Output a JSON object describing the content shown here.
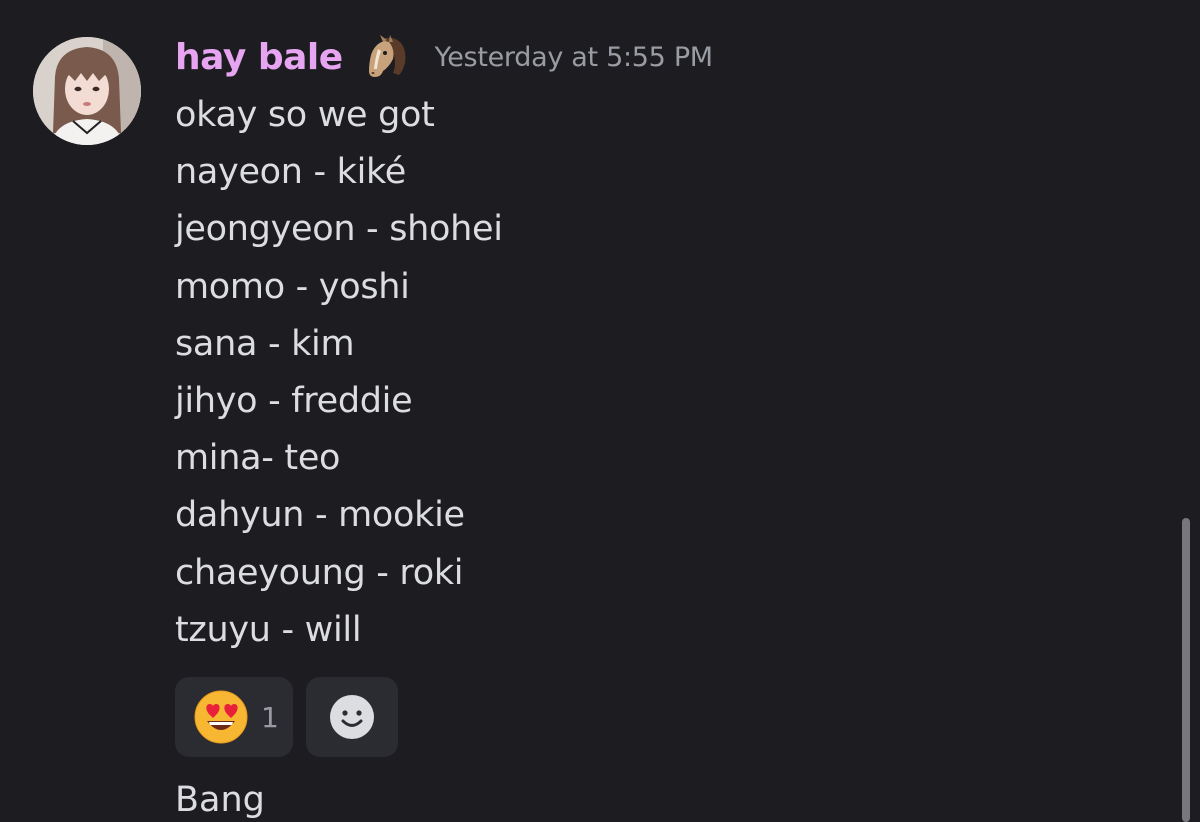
{
  "message": {
    "author": "hay bale",
    "badge_icon": "horse-face-icon",
    "timestamp": "Yesterday at 5:55 PM",
    "lines": [
      "okay so we got",
      "nayeon - kiké",
      "jeongyeon - shohei",
      "momo - yoshi",
      "sana - kim",
      "jihyo - freddie",
      "mina- teo",
      "dahyun - mookie",
      "chaeyoung - roki",
      "tzuyu - will"
    ],
    "reactions": [
      {
        "icon": "heart-eyes-emoji-icon",
        "count": "1"
      }
    ],
    "add_reaction_icon": "add-reaction-smiley-icon"
  },
  "next_message": {
    "text": "Bang"
  },
  "colors": {
    "background": "#1c1c21",
    "username": "#e6a4f1",
    "timestamp": "#9a9ca3",
    "text": "#dcdde1",
    "reaction_bg": "#2b2c32"
  }
}
